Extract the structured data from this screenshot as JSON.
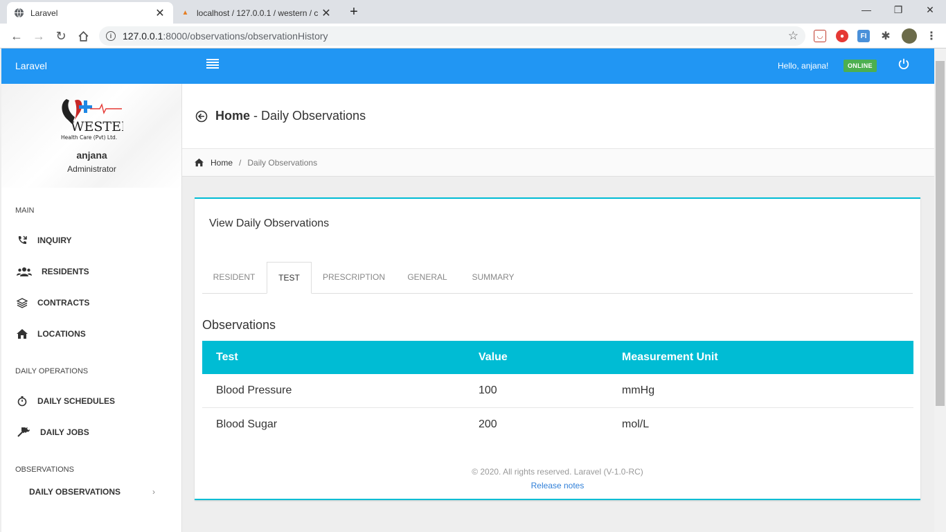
{
  "browser": {
    "tabs": [
      {
        "title": "Laravel",
        "active": true
      },
      {
        "title": "localhost / 127.0.0.1 / western / c",
        "active": false
      }
    ],
    "url_host": "127.0.0.1",
    "url_path": ":8000/observations/observationHistory"
  },
  "app": {
    "brand": "Laravel",
    "greeting": "Hello, anjana!",
    "status": "ONLINE",
    "accent": "#2196f3",
    "status_color": "#4caf50"
  },
  "sidebar": {
    "logo_brand": "WESTERN",
    "logo_sub": "Health Care (Pvt) Ltd.",
    "user_name": "anjana",
    "user_role": "Administrator",
    "sections": {
      "main": "MAIN",
      "daily_operations": "DAILY OPERATIONS",
      "observations": "OBSERVATIONS"
    },
    "items": {
      "inquiry": "INQUIRY",
      "residents": "RESIDENTS",
      "contracts": "CONTRACTS",
      "locations": "LOCATIONS",
      "daily_schedules": "DAILY SCHEDULES",
      "daily_jobs": "DAILY JOBS",
      "daily_observations": "DAILY OBSERVATIONS"
    }
  },
  "header": {
    "title_bold": "Home",
    "title_rest": " - Daily Observations"
  },
  "breadcrumb": {
    "home": "Home",
    "separator": "/",
    "current": "Daily Observations"
  },
  "card": {
    "title": "View Daily Observations",
    "tabs": {
      "resident": "RESIDENT",
      "test": "TEST",
      "prescription": "PRESCRIPTION",
      "general": "GENERAL",
      "summary": "SUMMARY"
    },
    "active_tab": "TEST",
    "section_title": "Observations",
    "table": {
      "columns": [
        "Test",
        "Value",
        "Measurement Unit"
      ],
      "rows": [
        [
          "Blood Pressure",
          "100",
          "mmHg"
        ],
        [
          "Blood Sugar",
          "200",
          "mol/L"
        ]
      ]
    },
    "table_color": "#00bcd4"
  },
  "footer": {
    "copyright": "© 2020. All rights reserved. Laravel (V-1.0-RC)",
    "release_notes": "Release notes"
  }
}
